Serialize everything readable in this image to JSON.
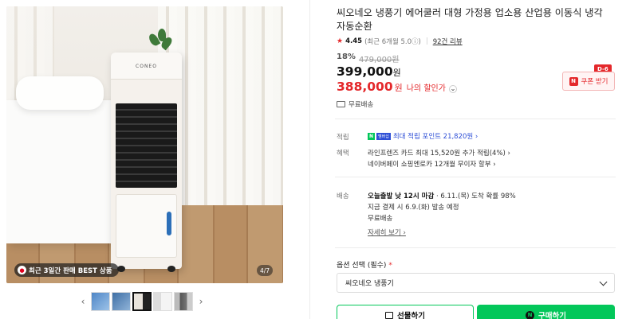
{
  "gallery": {
    "best_badge": "최근 3일간 판매 BEST 상품",
    "counter": "4/7",
    "product_brand": "CONEO"
  },
  "product": {
    "title": "씨오네오 냉풍기 에어쿨러 대형 가정용 업소용 산업용 이동식 냉각 자동순환",
    "rating": "4.45",
    "rating_detail": "(최근 6개월 5.0ⓘ)",
    "reviews": "92건 리뷰",
    "discount": "18%",
    "original_price": "479,000원",
    "price": "399,000",
    "price_unit": "원",
    "my_price": "388,000",
    "my_price_unit": "원",
    "my_price_label": "나의 할인가",
    "coupon_label": "쿠폰 받기",
    "coupon_dday": "D-6",
    "free_shipping": "무료배송"
  },
  "points": {
    "label": "적립",
    "npay_badge": "N",
    "npay_text": "멤버십",
    "max_points": "최대 적립 포인트 21,820원 ›"
  },
  "benefits": {
    "label": "혜택",
    "line1": "라인프렌즈 카드 최대 15,520원 추가 적립(4%) ›",
    "line2": "네이버페이 쇼핑엔로카 12개월 무이자 할부 ›"
  },
  "delivery": {
    "label": "배송",
    "line1_bold": "오늘출발 낮 12시 마감",
    "line1_rest": " · 6.11.(목) 도착 확률 98%",
    "line2": "지금 결제 시 6.9.(화) 발송 예정",
    "line3": "무료배송",
    "detail_link": "자세히 보기 ›"
  },
  "option": {
    "label": "옵션 선택 (필수)",
    "required_mark": "*",
    "selected": "씨오네오 냉풍기"
  },
  "actions": {
    "gift_label": "선물하기",
    "buy_label": "구매하기",
    "buy_icon": "N"
  },
  "colors": {
    "accent_red": "#e4282b",
    "naver_green": "#03c75a",
    "point_blue": "#2e4fd6"
  }
}
